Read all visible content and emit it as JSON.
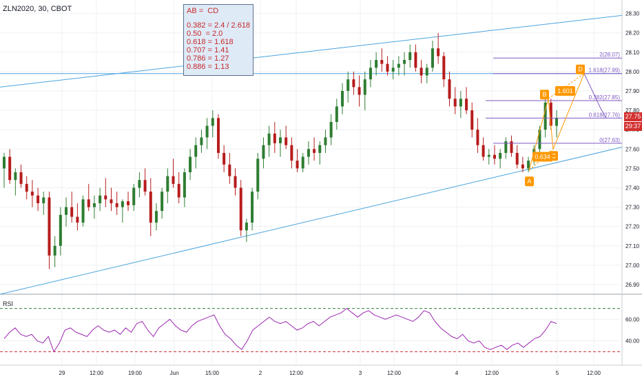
{
  "chart_data": [
    {
      "type": "candlestick",
      "title": "ZLN2020, 30, CBOT",
      "y_ticks": [
        "28.30",
        "28.20",
        "28.10",
        "28.00",
        "27.90",
        "27.80",
        "27.70",
        "27.60",
        "27.50",
        "27.40",
        "27.30",
        "27.20",
        "27.10",
        "27.00",
        "26.90"
      ],
      "ylim": [
        26.85,
        28.32
      ],
      "x_ticks": [
        "29",
        "12:00",
        "19:00",
        "Jun",
        "15:00",
        "2",
        "12:00",
        "3",
        "12:00",
        "4",
        "12:00",
        "5",
        "12:00"
      ],
      "last_price": "27.75",
      "countdown": "29:37",
      "candles": [
        [
          27.5,
          27.58,
          27.4,
          27.56
        ],
        [
          27.56,
          27.6,
          27.42,
          27.44
        ],
        [
          27.44,
          27.5,
          27.36,
          27.48
        ],
        [
          27.48,
          27.52,
          27.4,
          27.42
        ],
        [
          27.42,
          27.46,
          27.34,
          27.38
        ],
        [
          27.38,
          27.44,
          27.3,
          27.36
        ],
        [
          27.36,
          27.4,
          27.28,
          27.32
        ],
        [
          27.32,
          27.38,
          27.26,
          27.35
        ],
        [
          27.35,
          27.38,
          26.98,
          27.05
        ],
        [
          27.05,
          27.15,
          26.99,
          27.1
        ],
        [
          27.1,
          27.3,
          27.05,
          27.26
        ],
        [
          27.26,
          27.35,
          27.2,
          27.3
        ],
        [
          27.3,
          27.38,
          27.22,
          27.25
        ],
        [
          27.25,
          27.32,
          27.18,
          27.22
        ],
        [
          27.22,
          27.36,
          27.2,
          27.34
        ],
        [
          27.34,
          27.42,
          27.28,
          27.3
        ],
        [
          27.3,
          27.36,
          27.24,
          27.32
        ],
        [
          27.32,
          27.4,
          27.28,
          27.36
        ],
        [
          27.36,
          27.45,
          27.3,
          27.34
        ],
        [
          27.34,
          27.4,
          27.28,
          27.32
        ],
        [
          27.32,
          27.38,
          27.26,
          27.3
        ],
        [
          27.3,
          27.34,
          27.22,
          27.33
        ],
        [
          27.33,
          27.38,
          27.28,
          27.31
        ],
        [
          27.31,
          27.42,
          27.28,
          27.4
        ],
        [
          27.4,
          27.48,
          27.35,
          27.44
        ],
        [
          27.44,
          27.5,
          27.36,
          27.38
        ],
        [
          27.38,
          27.45,
          27.15,
          27.22
        ],
        [
          27.22,
          27.32,
          27.18,
          27.28
        ],
        [
          27.28,
          27.4,
          27.24,
          27.38
        ],
        [
          27.38,
          27.5,
          27.32,
          27.46
        ],
        [
          27.46,
          27.55,
          27.4,
          27.42
        ],
        [
          27.42,
          27.48,
          27.32,
          27.35
        ],
        [
          27.35,
          27.5,
          27.3,
          27.48
        ],
        [
          27.48,
          27.6,
          27.44,
          27.56
        ],
        [
          27.56,
          27.66,
          27.5,
          27.62
        ],
        [
          27.62,
          27.7,
          27.58,
          27.66
        ],
        [
          27.66,
          27.76,
          27.6,
          27.72
        ],
        [
          27.72,
          27.8,
          27.66,
          27.76
        ],
        [
          27.76,
          27.78,
          27.55,
          27.58
        ],
        [
          27.58,
          27.62,
          27.48,
          27.52
        ],
        [
          27.52,
          27.58,
          27.42,
          27.46
        ],
        [
          27.46,
          27.5,
          27.36,
          27.4
        ],
        [
          27.4,
          27.44,
          27.15,
          27.18
        ],
        [
          27.18,
          27.24,
          27.12,
          27.22
        ],
        [
          27.22,
          27.4,
          27.18,
          27.38
        ],
        [
          27.38,
          27.58,
          27.34,
          27.55
        ],
        [
          27.55,
          27.66,
          27.5,
          27.62
        ],
        [
          27.62,
          27.72,
          27.56,
          27.68
        ],
        [
          27.68,
          27.74,
          27.58,
          27.63
        ],
        [
          27.63,
          27.7,
          27.56,
          27.66
        ],
        [
          27.66,
          27.72,
          27.6,
          27.62
        ],
        [
          27.62,
          27.66,
          27.5,
          27.54
        ],
        [
          27.54,
          27.6,
          27.48,
          27.5
        ],
        [
          27.5,
          27.58,
          27.48,
          27.56
        ],
        [
          27.56,
          27.64,
          27.52,
          27.6
        ],
        [
          27.6,
          27.66,
          27.54,
          27.58
        ],
        [
          27.58,
          27.64,
          27.52,
          27.62
        ],
        [
          27.62,
          27.7,
          27.58,
          27.66
        ],
        [
          27.66,
          27.78,
          27.62,
          27.74
        ],
        [
          27.74,
          27.86,
          27.7,
          27.82
        ],
        [
          27.82,
          27.94,
          27.78,
          27.9
        ],
        [
          27.9,
          28.0,
          27.84,
          27.96
        ],
        [
          27.96,
          28.0,
          27.88,
          27.92
        ],
        [
          27.92,
          27.98,
          27.82,
          27.88
        ],
        [
          27.88,
          28.0,
          27.8,
          27.96
        ],
        [
          27.96,
          28.06,
          27.92,
          28.02
        ],
        [
          28.02,
          28.1,
          27.98,
          28.06
        ],
        [
          28.06,
          28.12,
          28.0,
          28.04
        ],
        [
          28.04,
          28.08,
          27.98,
          28.0
        ],
        [
          28.0,
          28.06,
          27.96,
          28.02
        ],
        [
          28.02,
          28.08,
          27.98,
          28.04
        ],
        [
          28.04,
          28.1,
          27.98,
          28.06
        ],
        [
          28.06,
          28.14,
          28.02,
          28.1
        ],
        [
          28.1,
          28.14,
          28.0,
          28.02
        ],
        [
          28.02,
          28.06,
          27.94,
          27.98
        ],
        [
          27.98,
          28.04,
          27.94,
          28.02
        ],
        [
          28.02,
          28.16,
          28.0,
          28.12
        ],
        [
          28.12,
          28.2,
          28.04,
          28.08
        ],
        [
          28.08,
          28.1,
          27.92,
          27.96
        ],
        [
          27.96,
          28.0,
          27.82,
          27.86
        ],
        [
          27.86,
          27.92,
          27.78,
          27.82
        ],
        [
          27.82,
          27.9,
          27.76,
          27.86
        ],
        [
          27.86,
          27.92,
          27.78,
          27.8
        ],
        [
          27.8,
          27.84,
          27.66,
          27.7
        ],
        [
          27.7,
          27.76,
          27.58,
          27.62
        ],
        [
          27.62,
          27.66,
          27.54,
          27.56
        ],
        [
          27.56,
          27.6,
          27.52,
          27.57
        ],
        [
          27.57,
          27.62,
          27.52,
          27.55
        ],
        [
          27.55,
          27.6,
          27.5,
          27.58
        ],
        [
          27.58,
          27.66,
          27.55,
          27.64
        ],
        [
          27.64,
          27.67,
          27.56,
          27.58
        ],
        [
          27.58,
          27.62,
          27.5,
          27.52
        ],
        [
          27.52,
          27.56,
          27.48,
          27.5
        ],
        [
          27.5,
          27.56,
          27.48,
          27.54
        ],
        [
          27.54,
          27.62,
          27.52,
          27.6
        ],
        [
          27.6,
          27.72,
          27.58,
          27.7
        ],
        [
          27.7,
          27.86,
          27.66,
          27.84
        ],
        [
          27.84,
          27.86,
          27.7,
          27.72
        ],
        [
          27.72,
          27.8,
          27.66,
          27.76
        ]
      ],
      "rsi": {
        "label": "RSI",
        "ticks": [
          "60.00",
          "40.00"
        ],
        "upper_level": 70,
        "lower_level": 30,
        "values": [
          42,
          48,
          52,
          46,
          44,
          46,
          40,
          38,
          44,
          30,
          38,
          50,
          52,
          48,
          46,
          44,
          50,
          54,
          50,
          48,
          50,
          46,
          52,
          48,
          56,
          58,
          50,
          44,
          52,
          56,
          60,
          54,
          50,
          48,
          54,
          58,
          60,
          62,
          64,
          54,
          46,
          42,
          36,
          32,
          40,
          50,
          54,
          58,
          62,
          58,
          56,
          58,
          54,
          50,
          52,
          56,
          58,
          54,
          58,
          62,
          64,
          66,
          70,
          66,
          62,
          66,
          68,
          64,
          62,
          60,
          62,
          64,
          62,
          60,
          58,
          62,
          68,
          66,
          58,
          52,
          48,
          44,
          42,
          46,
          40,
          38,
          40,
          34,
          32,
          34,
          36,
          32,
          36,
          38,
          34,
          38,
          42,
          44,
          50,
          58,
          56
        ]
      },
      "harmonic_pattern": {
        "points": [
          "A",
          "B",
          "C",
          "D"
        ],
        "ratios": [
          "1.601",
          "0.634"
        ]
      },
      "fib_levels": [
        "2(28.07)",
        "1.618(27.99)",
        "0.382(27.85)",
        "0.618(27.76)",
        "0(27.63)"
      ]
    }
  ],
  "note": {
    "title": "AB =  CD",
    "lines": [
      "0.382 = 2.4 / 2.618",
      "0.50  = 2.0",
      "0.618 = 1.618",
      "0.707 = 1.41",
      "0.786 = 1.27",
      "0.886 = 1.13"
    ]
  },
  "colors": {
    "up": "#26a69a",
    "down": "#ef5350",
    "candle_up": "#2e7d32",
    "candle_down": "#b71c1c",
    "trendline": "#4aa3df",
    "fib": "#7e57c2",
    "pattern": "#ff9800",
    "rsi": "#9c27b0",
    "price_tag": "#d32f2f"
  }
}
